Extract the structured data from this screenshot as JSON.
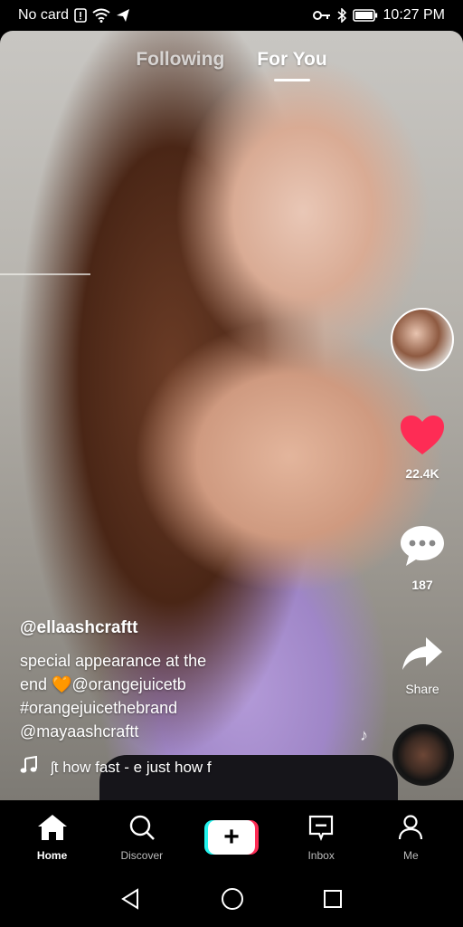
{
  "status_bar": {
    "carrier": "No card",
    "time": "10:27 PM"
  },
  "top_tabs": {
    "following": "Following",
    "for_you": "For You"
  },
  "actions": {
    "likes": "22.4K",
    "comments": "187",
    "share": "Share",
    "like_color": "#fe2c55"
  },
  "caption": {
    "username": "@ellaashcraftt",
    "line1": "special appearance at the",
    "line2_prefix": "end ",
    "line2_emoji": "🧡",
    "line2_mention": "@orangejuicetb",
    "line3": "#orangejuicethebrand",
    "line4": "@mayaashcraftt",
    "music": "ʃt how fast - e    just how f"
  },
  "bottom_nav": {
    "home": "Home",
    "discover": "Discover",
    "create": "+",
    "inbox": "Inbox",
    "me": "Me"
  },
  "colors": {
    "create_left": "#25f4ee",
    "create_right": "#fe2c55"
  }
}
